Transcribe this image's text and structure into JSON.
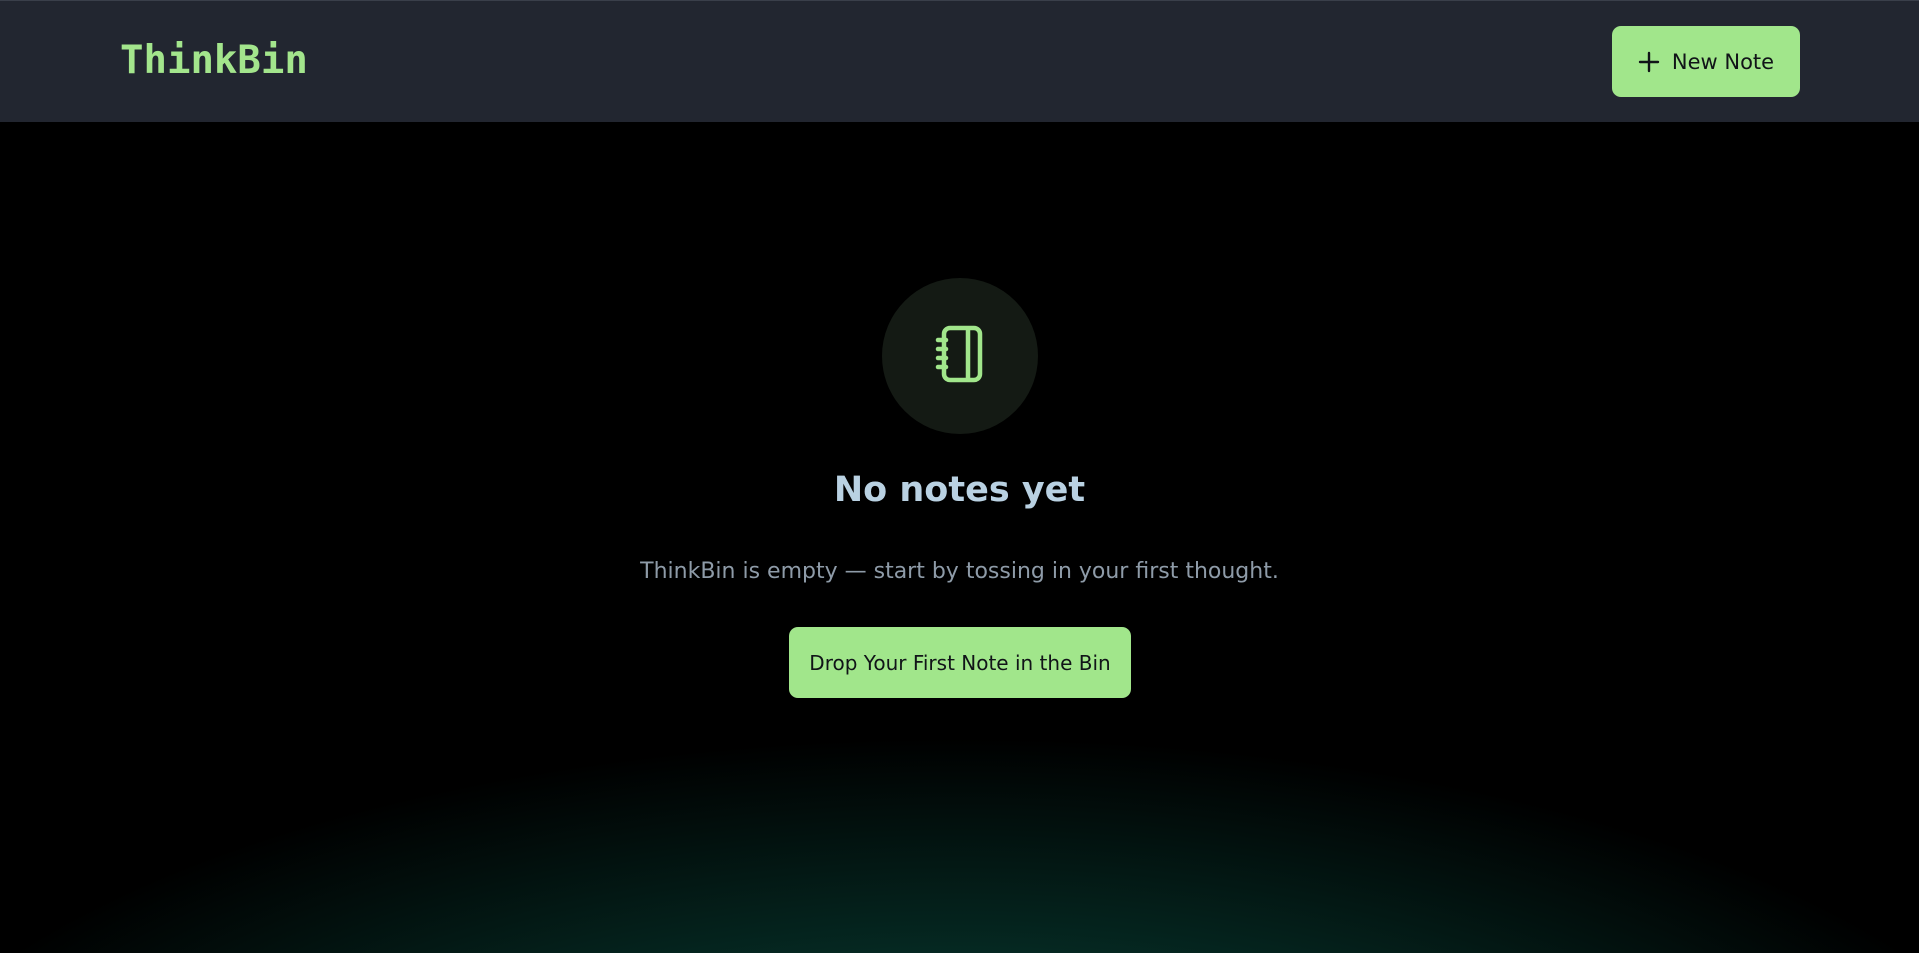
{
  "header": {
    "logo": "ThinkBin",
    "new_note_label": "New Note",
    "new_note_icon": "plus-icon"
  },
  "empty_state": {
    "icon": "notebook-icon",
    "title": "No notes yet",
    "description": "ThinkBin is empty — start by tossing in your first thought.",
    "cta_label": "Drop Your First Note in the Bin"
  },
  "colors": {
    "accent": "#a1e68b",
    "header_bg": "#222630",
    "title": "#b9d1e2",
    "muted_text": "#8e9ba8"
  }
}
